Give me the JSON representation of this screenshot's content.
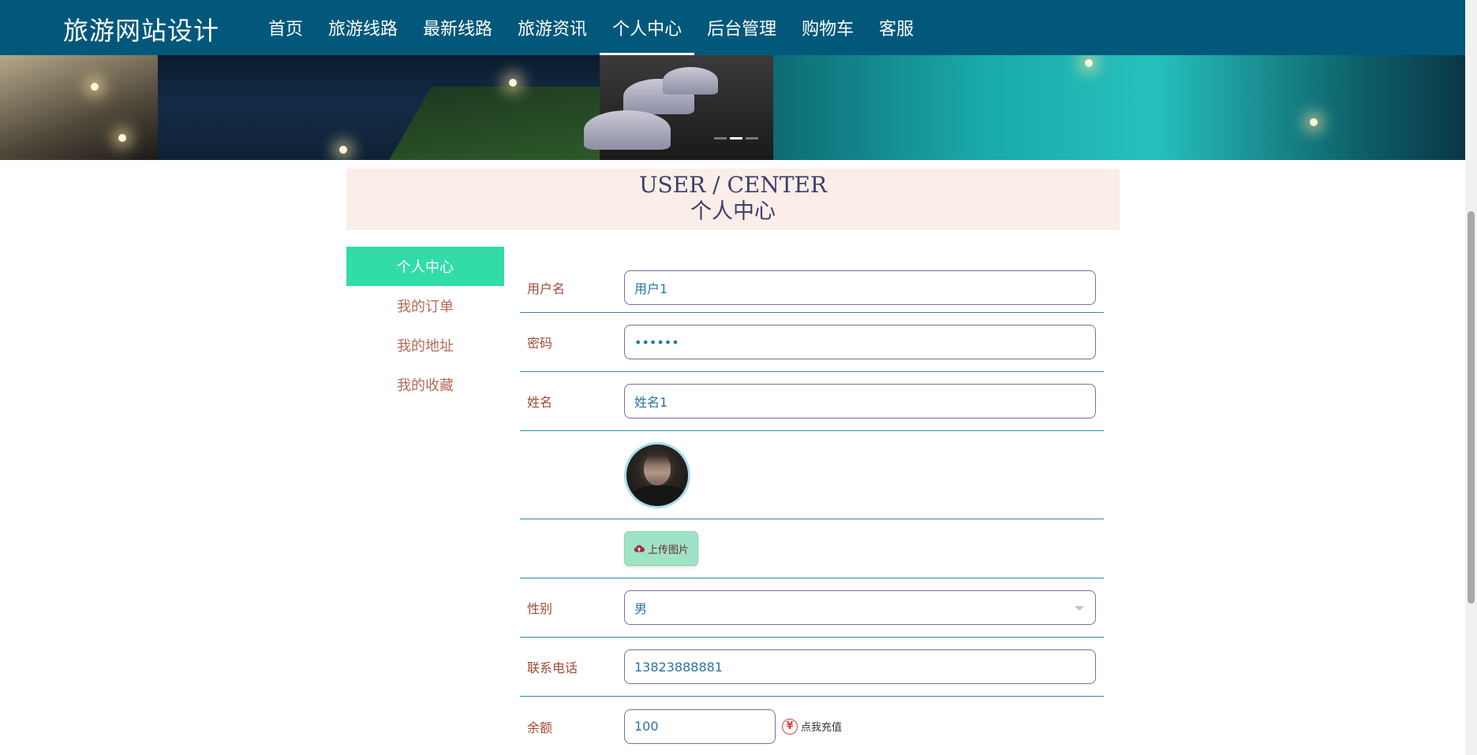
{
  "header": {
    "brand": "旅游网站设计",
    "nav": [
      {
        "label": "首页",
        "active": false
      },
      {
        "label": "旅游线路",
        "active": false
      },
      {
        "label": "最新线路",
        "active": false
      },
      {
        "label": "旅游资讯",
        "active": false
      },
      {
        "label": "个人中心",
        "active": true
      },
      {
        "label": "后台管理",
        "active": false
      },
      {
        "label": "购物车",
        "active": false
      },
      {
        "label": "客服",
        "active": false
      }
    ]
  },
  "banner": {
    "slides": 3,
    "active_slide": 2
  },
  "title": {
    "en": "USER / CENTER",
    "cn": "个人中心"
  },
  "sidebar": {
    "items": [
      {
        "label": "个人中心",
        "active": true
      },
      {
        "label": "我的订单",
        "active": false
      },
      {
        "label": "我的地址",
        "active": false
      },
      {
        "label": "我的收藏",
        "active": false
      }
    ]
  },
  "form": {
    "username": {
      "label": "用户名",
      "value": "用户1"
    },
    "password": {
      "label": "密码",
      "value": "••••••"
    },
    "name": {
      "label": "姓名",
      "value": "姓名1"
    },
    "upload": {
      "label": "上传图片"
    },
    "gender": {
      "label": "性别",
      "value": "男"
    },
    "phone": {
      "label": "联系电话",
      "value": "13823888881"
    },
    "balance": {
      "label": "余额",
      "value": "100",
      "recharge_label": "点我充值"
    }
  },
  "colors": {
    "header_bg": "#02587b",
    "sidebar_active": "#32dca9",
    "title_bg": "#fbeee8",
    "label": "#a04b35",
    "row_border": "#2d8aa8"
  }
}
